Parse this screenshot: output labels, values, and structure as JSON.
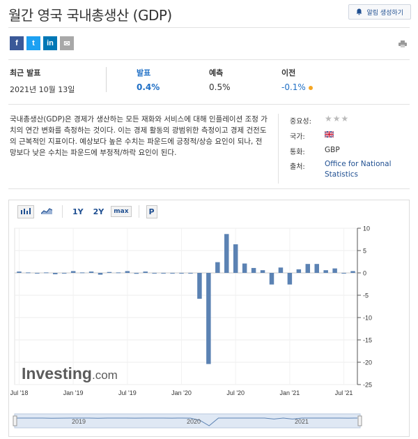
{
  "header": {
    "title": "월간 영국 국내총생산 (GDP)",
    "alert_label": "알림 생성하기"
  },
  "social": [
    "f",
    "t",
    "in",
    "✉"
  ],
  "stats": {
    "latest_label": "최근 발표",
    "latest_date": "2021년 10월 13일",
    "actual_label": "발표",
    "actual_value": "0.4%",
    "forecast_label": "예측",
    "forecast_value": "0.5%",
    "previous_label": "이전",
    "previous_value": "-0.1%"
  },
  "description": "국내총생산(GDP)은 경제가 생산하는 모든 재화와 서비스에 대해 인플레이션 조정 가치의 연간 변화를 측정하는 것이다. 이는 경제 활동의 광범위한 측정이고 경제 건전도의 근복적인 지표이다. 예상보다 높은 수치는 파운드에 긍정적/상승 요인이 되나, 전망보다 낮은 수치는 파운드에 부정적/하락 요인이 된다.",
  "meta": {
    "importance_label": "중요성:",
    "importance_stars": 3,
    "country_label": "국가:",
    "country_flag": "uk-flag-icon",
    "currency_label": "통화:",
    "currency_value": "GBP",
    "source_label": "출처:",
    "source_line1": "Office for National",
    "source_line2": "Statistics"
  },
  "toolbar": {
    "range_1y": "1Y",
    "range_2y": "2Y",
    "range_max": "max",
    "p_label": "P"
  },
  "watermark": {
    "brand": "Investing",
    "suffix": ".com"
  },
  "colors": {
    "bar": "#5b82b3",
    "accent": "#1f6fc5",
    "link": "#1f4f91",
    "dot": "#f5a623"
  },
  "chart_data": {
    "type": "bar",
    "x": [
      "2018-07",
      "2018-08",
      "2018-09",
      "2018-10",
      "2018-11",
      "2018-12",
      "2019-01",
      "2019-02",
      "2019-03",
      "2019-04",
      "2019-05",
      "2019-06",
      "2019-07",
      "2019-08",
      "2019-09",
      "2019-10",
      "2019-11",
      "2019-12",
      "2020-01",
      "2020-02",
      "2020-03",
      "2020-04",
      "2020-05",
      "2020-06",
      "2020-07",
      "2020-08",
      "2020-09",
      "2020-10",
      "2020-11",
      "2020-12",
      "2021-01",
      "2021-02",
      "2021-03",
      "2021-04",
      "2021-05",
      "2021-06",
      "2021-07",
      "2021-08"
    ],
    "values": [
      0.3,
      0.1,
      0.0,
      0.1,
      -0.3,
      -0.1,
      0.4,
      0.1,
      0.3,
      -0.4,
      0.2,
      0.1,
      0.4,
      -0.2,
      0.3,
      0.0,
      0.0,
      -0.1,
      0.0,
      -0.1,
      -5.8,
      -20.4,
      2.4,
      8.7,
      6.4,
      2.1,
      1.1,
      0.6,
      -2.6,
      1.2,
      -2.6,
      0.8,
      2.0,
      2.0,
      0.6,
      1.0,
      -0.1,
      0.4
    ],
    "ylim": [
      -25,
      10
    ],
    "yticks": [
      10,
      5,
      0,
      -5,
      -10,
      -15,
      -20,
      -25
    ],
    "xtick_labels": [
      {
        "label": "Jul '18",
        "index": 0
      },
      {
        "label": "Jan '19",
        "index": 6
      },
      {
        "label": "Jul '19",
        "index": 12
      },
      {
        "label": "Jan '20",
        "index": 18
      },
      {
        "label": "Jul '20",
        "index": 24
      },
      {
        "label": "Jan '21",
        "index": 30
      },
      {
        "label": "Jul '21",
        "index": 36
      }
    ],
    "navigator_labels": [
      "2019",
      "2020",
      "2021"
    ],
    "grid": true
  }
}
